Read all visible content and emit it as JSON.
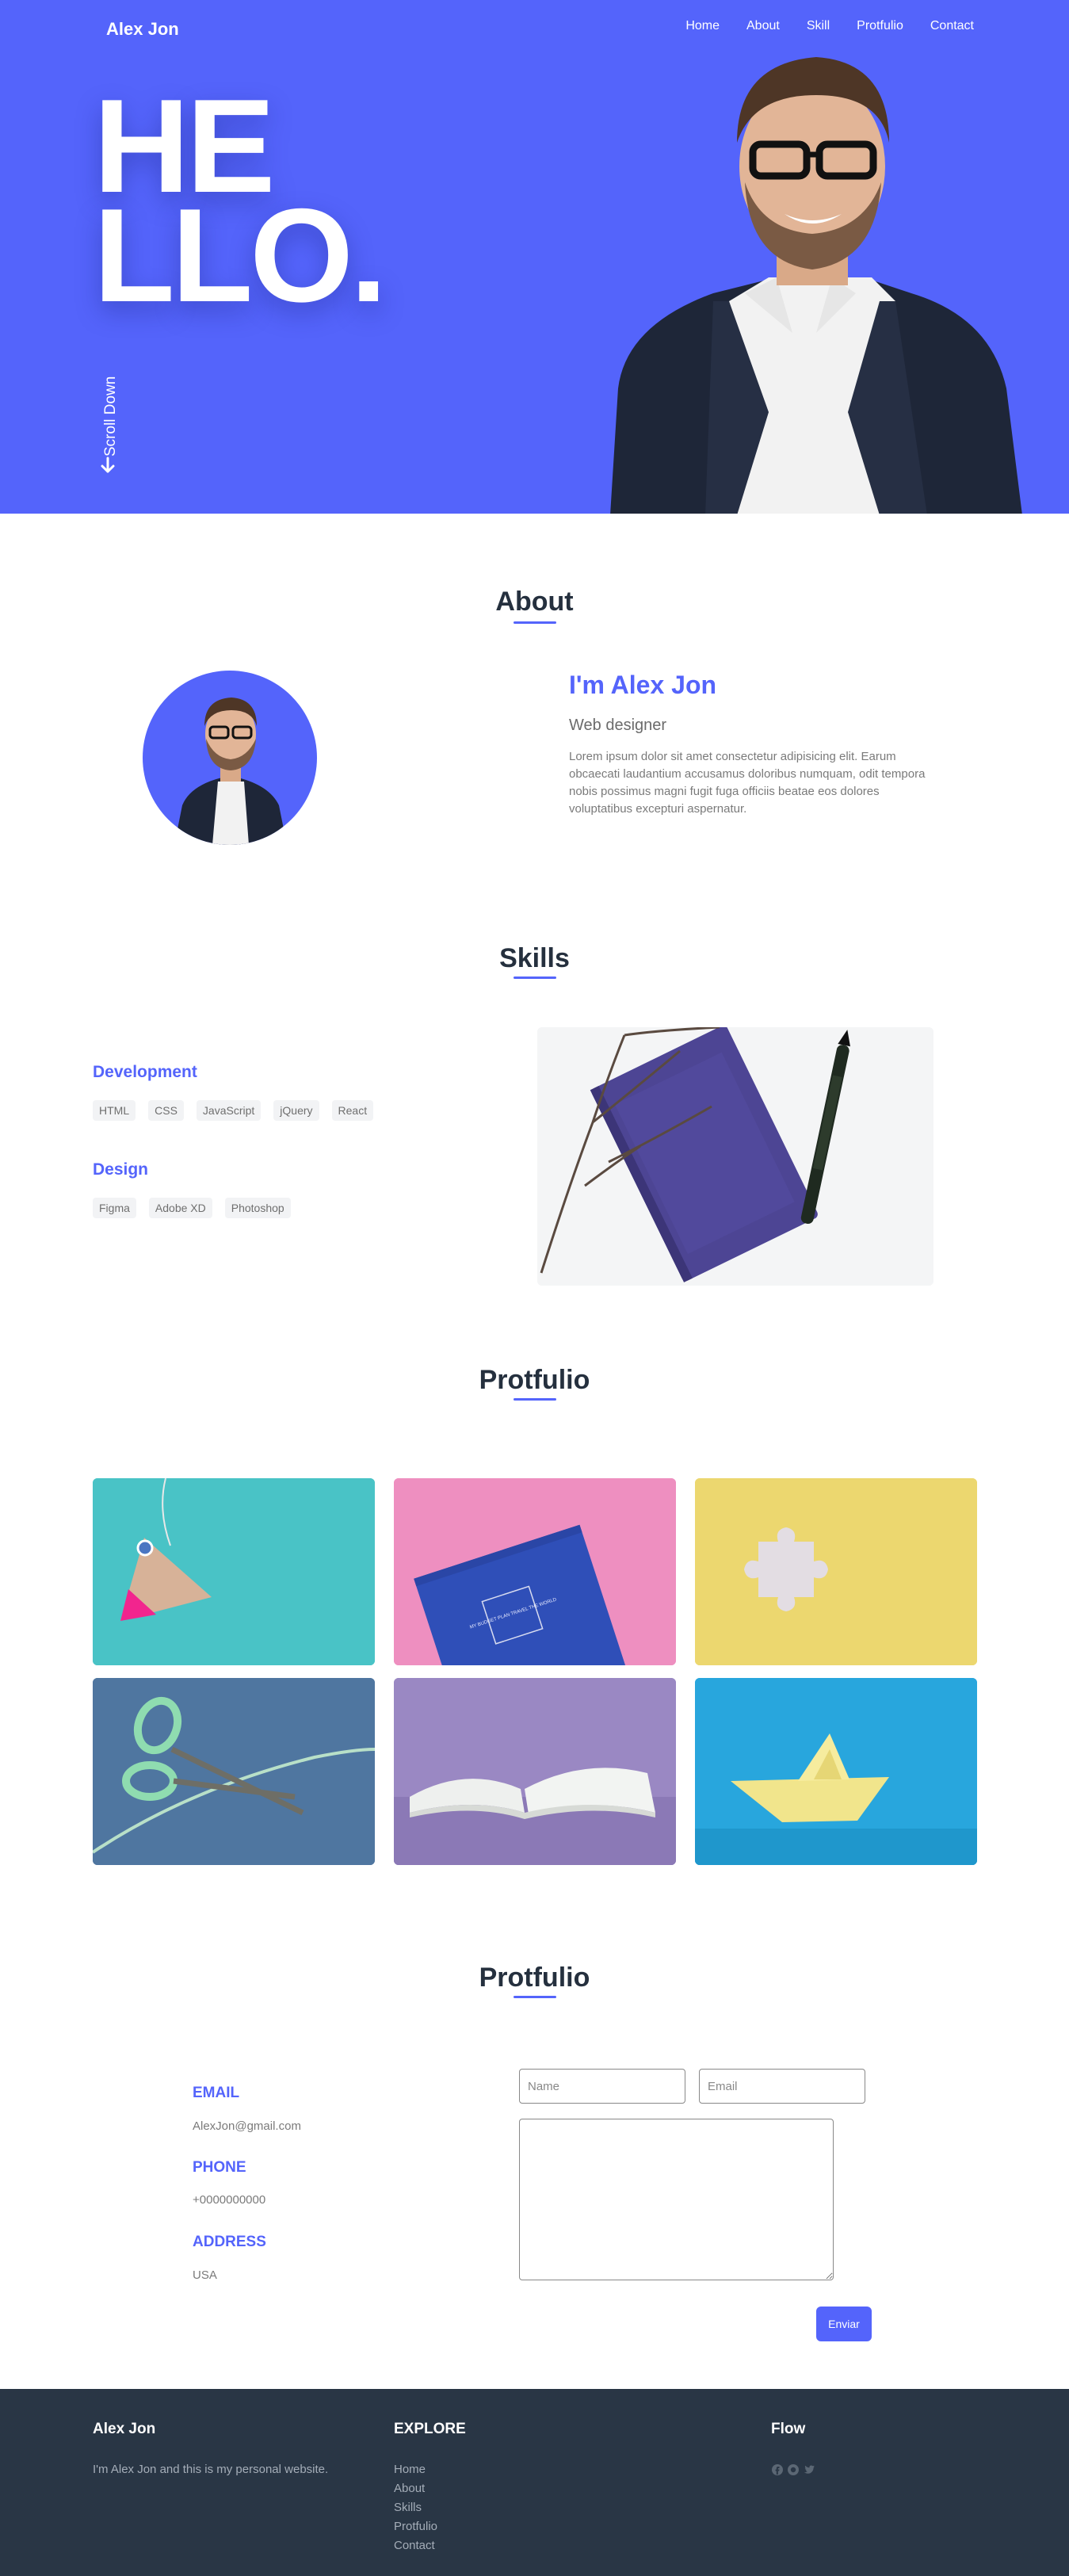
{
  "header": {
    "brand": "Alex Jon",
    "nav": [
      "Home",
      "About",
      "Skill",
      "Protfulio",
      "Contact"
    ]
  },
  "hero": {
    "line1": "HE",
    "line2": "LLO.",
    "scroll_label": "Scroll Down"
  },
  "about": {
    "title": "About",
    "name": "I'm Alex Jon",
    "role": "Web designer",
    "text": "Lorem ipsum dolor sit amet consectetur adipisicing elit. Earum obcaecati laudantium accusamus doloribus numquam, odit tempora nobis possimus magni fugit fuga officiis beatae eos dolores voluptatibus excepturi aspernatur."
  },
  "skills": {
    "title": "Skills",
    "groups": [
      {
        "name": "Development",
        "items": [
          "HTML",
          "CSS",
          "JavaScript",
          "jQuery",
          "React"
        ]
      },
      {
        "name": "Design",
        "items": [
          "Figma",
          "Adobe XD",
          "Photoshop"
        ]
      }
    ]
  },
  "portfolio": {
    "title": "Protfulio",
    "book_cover_text": "MY BUDGET PLAN TRAVEL THE WORLD"
  },
  "contact": {
    "title": "Protfulio",
    "email_label": "EMAIL",
    "email_value": "AlexJon@gmail.com",
    "phone_label": "PHONE",
    "phone_value": "+0000000000",
    "address_label": "ADDRESS",
    "address_value": "USA",
    "name_placeholder": "Name",
    "email_placeholder": "Email",
    "message_placeholder": "",
    "send_label": "Enviar"
  },
  "footer": {
    "brand": "Alex Jon",
    "tagline": "I'm Alex Jon and this is my personal website.",
    "explore_title": "EXPLORE",
    "links": [
      "Home",
      "About",
      "Skills",
      "Protfulio",
      "Contact"
    ],
    "flow_title": "Flow",
    "social_icons": [
      "facebook-icon",
      "github-icon",
      "twitter-icon"
    ]
  },
  "colors": {
    "accent": "#5464fb",
    "footer_bg": "#293645",
    "heading": "#25303e"
  }
}
